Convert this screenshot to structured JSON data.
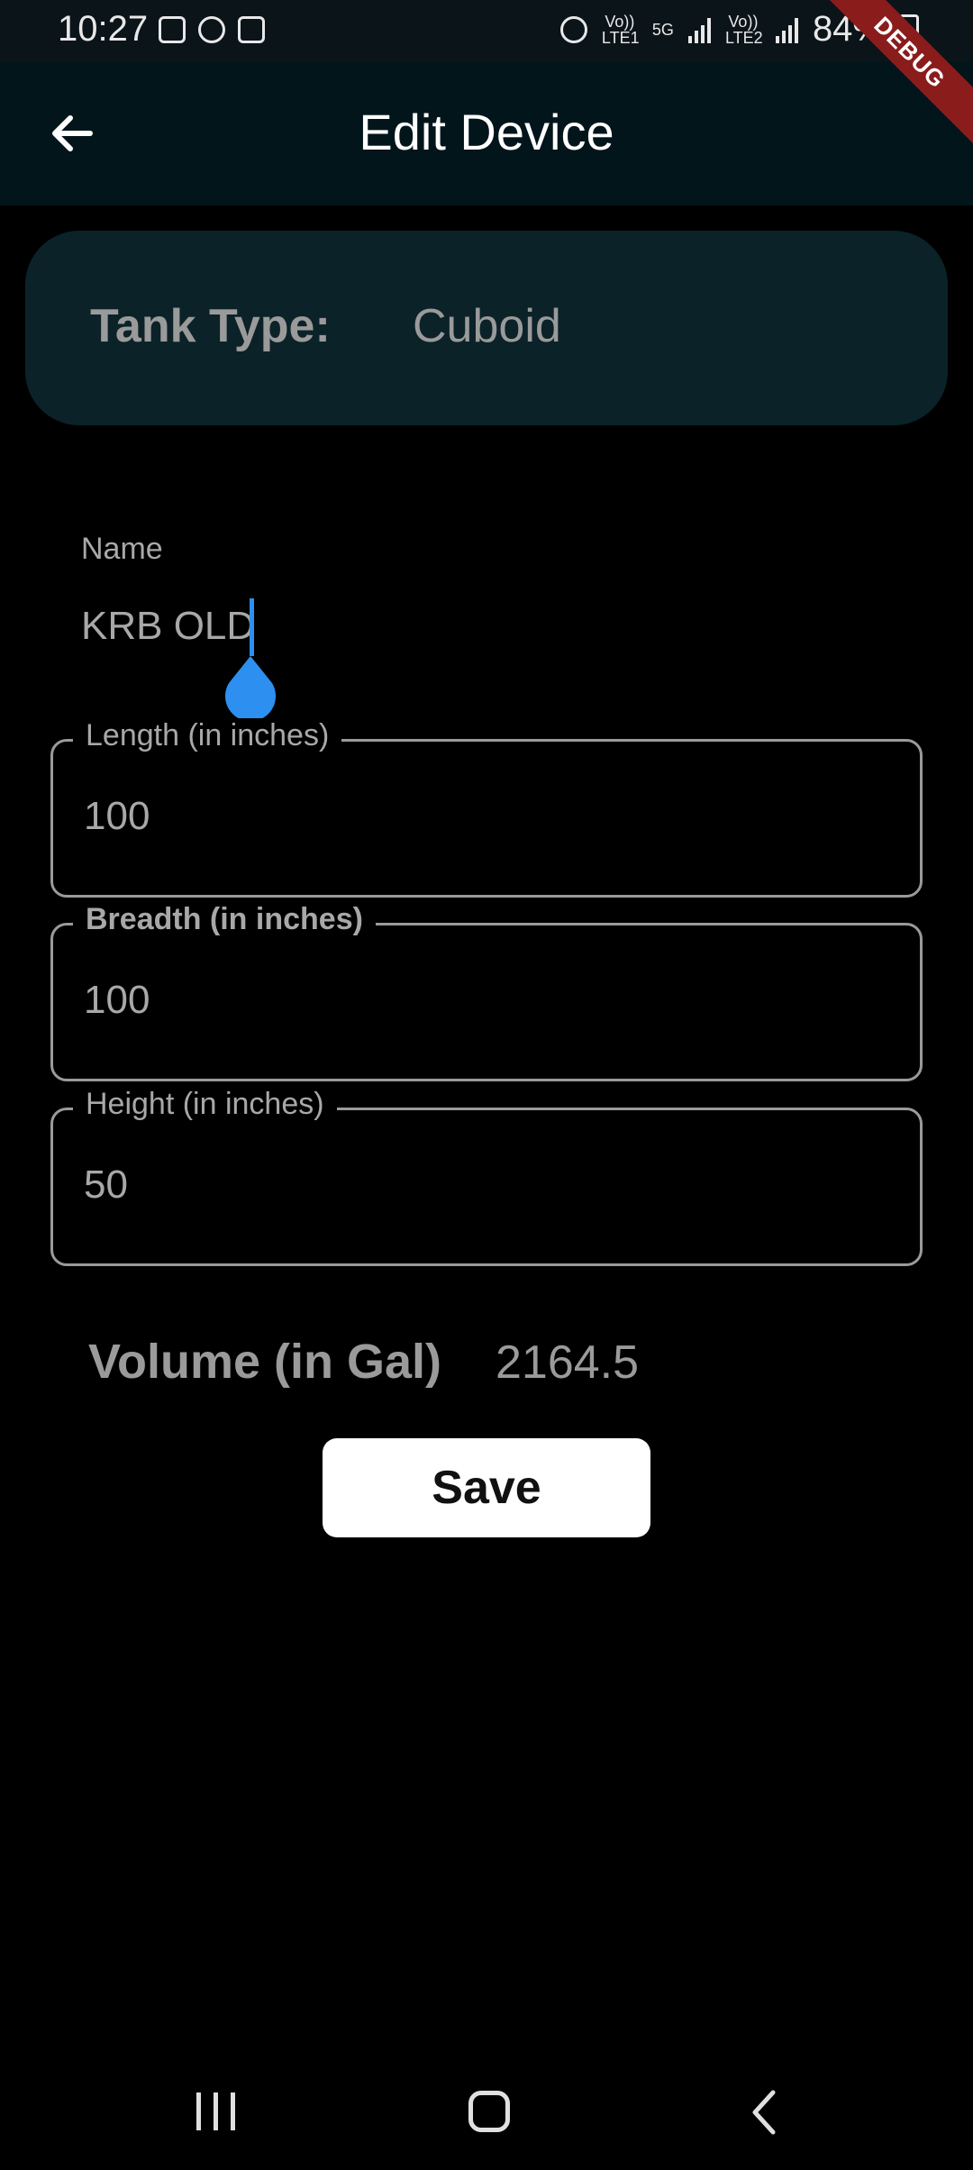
{
  "status_bar": {
    "time": "10:27",
    "network_labels": [
      "Vo)) LTE1",
      "5G",
      "Vo)) LTE2"
    ],
    "battery": "84%"
  },
  "debug_banner": "DEBUG",
  "app_bar": {
    "title": "Edit Device",
    "back_icon": "arrow-left-icon"
  },
  "tank": {
    "label": "Tank Type:",
    "value": "Cuboid"
  },
  "name_field": {
    "label": "Name",
    "value": "KRB OLD"
  },
  "fields": [
    {
      "label": "Length (in inches)",
      "value": "100"
    },
    {
      "label": "Breadth (in inches)",
      "value": "100"
    },
    {
      "label": "Height (in inches)",
      "value": "50"
    }
  ],
  "volume": {
    "label": "Volume (in Gal)",
    "value": "2164.5"
  },
  "save_button": "Save",
  "colors": {
    "accent": "#2d8ff0",
    "appbar": "#02151b",
    "card": "#0b2228",
    "debug": "#8a1c1c"
  }
}
